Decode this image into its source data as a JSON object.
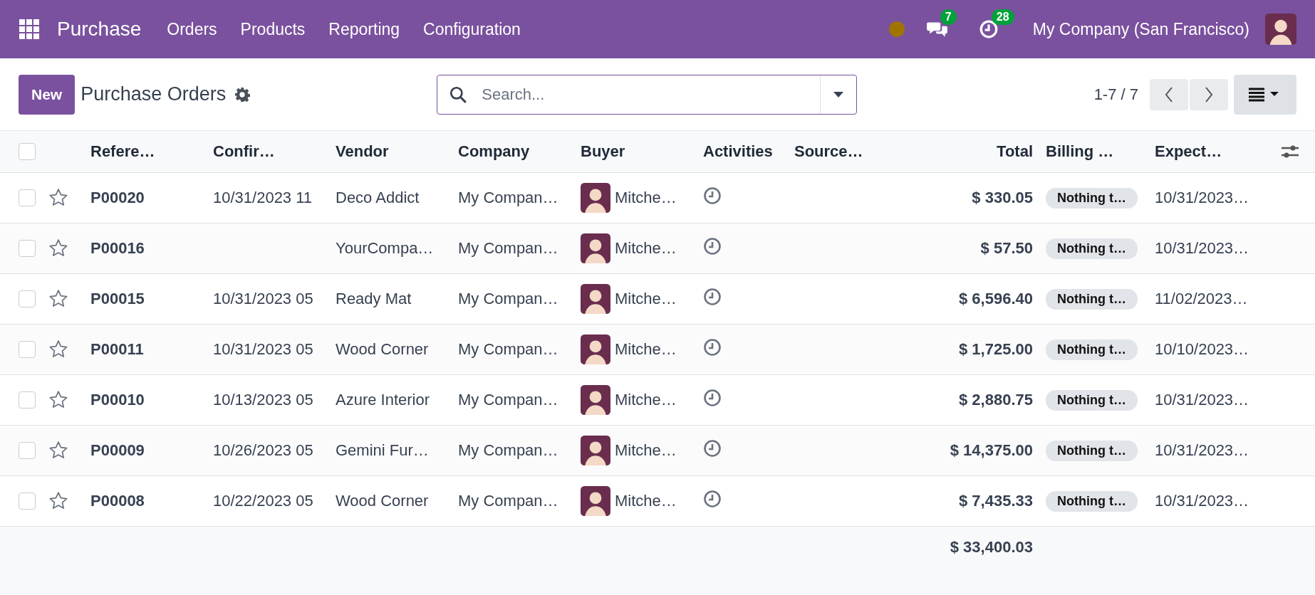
{
  "navbar": {
    "app_name": "Purchase",
    "menu": [
      "Orders",
      "Products",
      "Reporting",
      "Configuration"
    ],
    "messages_count": "7",
    "activities_count": "28",
    "company": "My Company (San Francisco)"
  },
  "control_panel": {
    "new_button": "New",
    "title": "Purchase Orders",
    "search": {
      "placeholder": "Search..."
    },
    "pager": "1-7 / 7"
  },
  "table": {
    "columns": [
      "Refere…",
      "Confir…",
      "Vendor",
      "Company",
      "Buyer",
      "Activities",
      "Source…",
      "Total",
      "Billing …",
      "Expect…"
    ],
    "all_checked": false,
    "rows": [
      {
        "checked": false,
        "starred": false,
        "reference": "P00020",
        "confirmation": "10/31/2023 11",
        "vendor": "Deco Addict",
        "company": "My Compan…",
        "buyer": "Mitche…",
        "total": "$ 330.05",
        "billing": "Nothing t…",
        "expected": "10/31/2023…"
      },
      {
        "checked": false,
        "starred": false,
        "reference": "P00016",
        "vendor": "YourCompa…",
        "company": "My Compan…",
        "buyer": "Mitche…",
        "total": "$ 57.50",
        "billing": "Nothing t…",
        "expected": "10/31/2023…"
      },
      {
        "checked": false,
        "starred": false,
        "reference": "P00015",
        "confirmation": "10/31/2023 05",
        "vendor": "Ready Mat",
        "company": "My Compan…",
        "buyer": "Mitche…",
        "total": "$ 6,596.40",
        "billing": "Nothing t…",
        "expected": "11/02/2023…"
      },
      {
        "checked": false,
        "starred": false,
        "reference": "P00011",
        "confirmation": "10/31/2023 05",
        "vendor": "Wood Corner",
        "company": "My Compan…",
        "buyer": "Mitche…",
        "total": "$ 1,725.00",
        "billing": "Nothing t…",
        "expected": "10/10/2023…"
      },
      {
        "checked": false,
        "starred": false,
        "reference": "P00010",
        "confirmation": "10/13/2023 05",
        "vendor": "Azure Interior",
        "company": "My Compan…",
        "buyer": "Mitche…",
        "total": "$ 2,880.75",
        "billing": "Nothing t…",
        "expected": "10/31/2023…"
      },
      {
        "checked": false,
        "starred": false,
        "reference": "P00009",
        "confirmation": "10/26/2023 05",
        "vendor": "Gemini Fur…",
        "company": "My Compan…",
        "buyer": "Mitche…",
        "total": "$ 14,375.00",
        "billing": "Nothing t…",
        "expected": "10/31/2023…"
      },
      {
        "checked": false,
        "starred": false,
        "reference": "P00008",
        "confirmation": "10/22/2023 05",
        "vendor": "Wood Corner",
        "company": "My Compan…",
        "buyer": "Mitche…",
        "total": "$ 7,435.33",
        "billing": "Nothing t…",
        "expected": "10/31/2023…"
      }
    ],
    "footer_total": "$ 33,400.03"
  }
}
